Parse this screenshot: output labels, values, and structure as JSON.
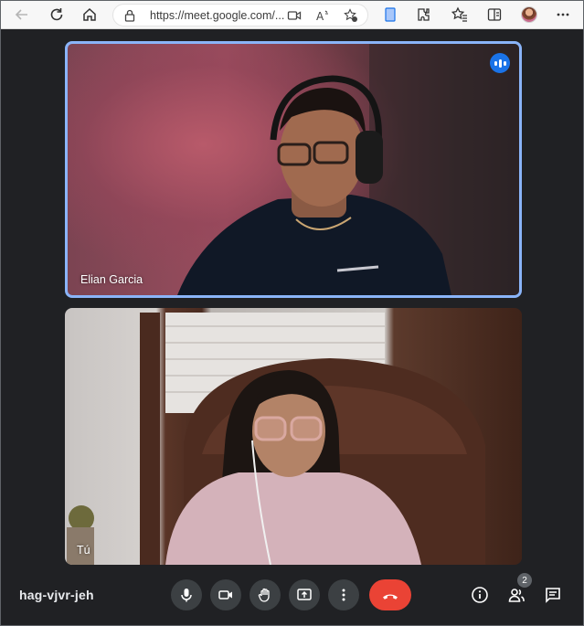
{
  "browser": {
    "url": "https://meet.google.com/...",
    "icons": [
      "back-icon",
      "refresh-icon",
      "home-icon",
      "lock-icon",
      "camera-icon",
      "read-aloud-icon",
      "favorites-add-icon",
      "collections-icon",
      "extensions-icon",
      "favorites-icon",
      "split-screen-icon",
      "profile-avatar",
      "more-icon"
    ]
  },
  "tiles": {
    "remote": {
      "name": "Elian Garcia"
    },
    "self": {
      "name": "Tú"
    }
  },
  "meeting": {
    "code": "hag-vjvr-jeh",
    "participants_count": "2"
  },
  "colors": {
    "active_speaker_border": "#8ab4f8",
    "end_call": "#ea4335",
    "control_bg": "#3c4043",
    "background": "#202124"
  }
}
